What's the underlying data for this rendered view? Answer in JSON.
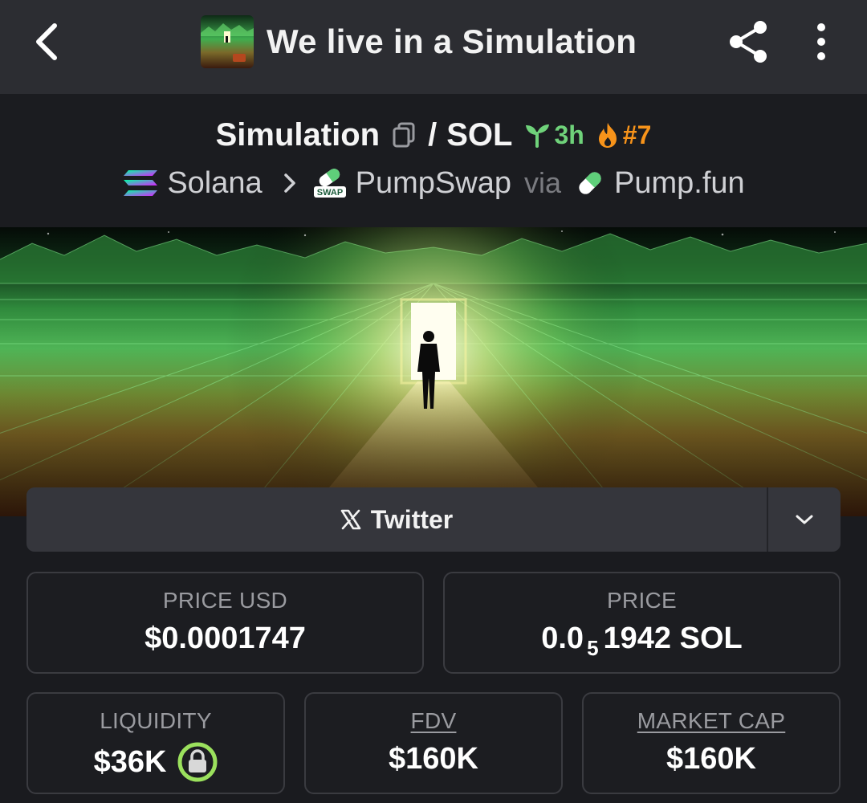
{
  "header": {
    "title": "We live in a Simulation"
  },
  "pair": {
    "base": "Simulation",
    "separator": "/",
    "quote": "SOL",
    "age": "3h",
    "rank": "#7"
  },
  "route": {
    "chain": "Solana",
    "dex": "PumpSwap",
    "dex_badge": "SWAP",
    "via": "via",
    "launchpad": "Pump.fun"
  },
  "socials": {
    "twitter_label": "Twitter"
  },
  "stats": {
    "price_usd_label": "PRICE USD",
    "price_usd_value": "$0.0001747",
    "price_label": "PRICE",
    "price_prefix": "0.0",
    "price_zeros": "5",
    "price_digits": "1942 SOL",
    "liquidity_label": "LIQUIDITY",
    "liquidity_value": "$36K",
    "fdv_label": "FDV",
    "fdv_value": "$160K",
    "mcap_label": "MARKET CAP",
    "mcap_value": "$160K"
  },
  "colors": {
    "age_green": "#6fd27a",
    "rank_orange": "#f7931a",
    "lock_green": "#9be15d"
  }
}
